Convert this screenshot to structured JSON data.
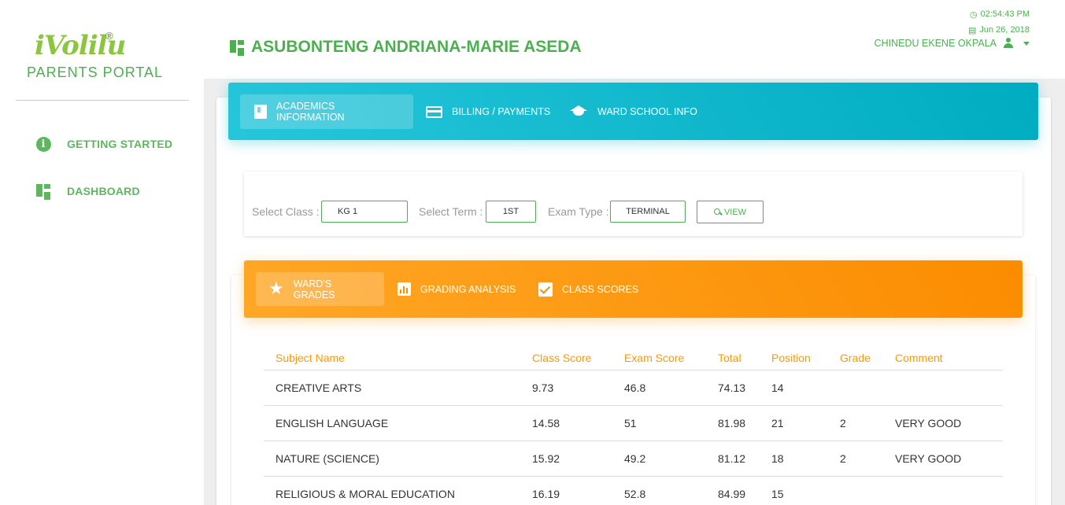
{
  "brand": {
    "logo_text": "iVolilu",
    "registered_mark": "®",
    "portal_label": "PARENTS PORTAL",
    "accent_color": "#4caf50"
  },
  "sidebar": {
    "items": [
      {
        "label": "GETTING STARTED",
        "icon": "info-icon"
      },
      {
        "label": "DASHBOARD",
        "icon": "dashboard-grid-icon"
      }
    ]
  },
  "header": {
    "student_name": "ASUBONTENG ANDRIANA-MARIE ASEDA",
    "time": "02:54:43 PM",
    "date": "Jun 26, 2018",
    "user_name": "CHINEDU EKENE OKPALA"
  },
  "main_tabs": [
    {
      "label": "ACADEMICS INFORMATION",
      "icon": "book-icon",
      "active": true
    },
    {
      "label": "BILLING / PAYMENTS",
      "icon": "credit-card-icon",
      "active": false
    },
    {
      "label": "WARD SCHOOL INFO",
      "icon": "graduation-cap-icon",
      "active": false
    }
  ],
  "filters": {
    "class_label": "Select Class :",
    "class_value": "KG 1",
    "term_label": "Select Term :",
    "term_value": "1ST",
    "exam_label": "Exam Type :",
    "exam_value": "TERMINAL",
    "view_label": "VIEW"
  },
  "sub_tabs": [
    {
      "label": "WARD'S GRADES",
      "icon": "star-icon",
      "active": true
    },
    {
      "label": "GRADING ANALYSIS",
      "icon": "bar-chart-icon",
      "active": false
    },
    {
      "label": "CLASS SCORES",
      "icon": "checkbox-icon",
      "active": false
    }
  ],
  "grades_table": {
    "columns": [
      "Subject Name",
      "Class Score",
      "Exam Score",
      "Total",
      "Position",
      "Grade",
      "Comment"
    ],
    "rows": [
      [
        "CREATIVE ARTS",
        "9.73",
        "46.8",
        "74.13",
        "14",
        "",
        ""
      ],
      [
        "ENGLISH LANGUAGE",
        "14.58",
        "51",
        "81.98",
        "21",
        "2",
        "VERY GOOD"
      ],
      [
        "NATURE (SCIENCE)",
        "15.92",
        "49.2",
        "81.12",
        "18",
        "2",
        "VERY GOOD"
      ],
      [
        "RELIGIOUS & MORAL EDUCATION",
        "16.19",
        "52.8",
        "84.99",
        "15",
        "",
        ""
      ]
    ]
  },
  "colors": {
    "tabs_bar": "#00bcd4",
    "grades_bar": "#ff9800",
    "table_header": "#ff9800"
  }
}
